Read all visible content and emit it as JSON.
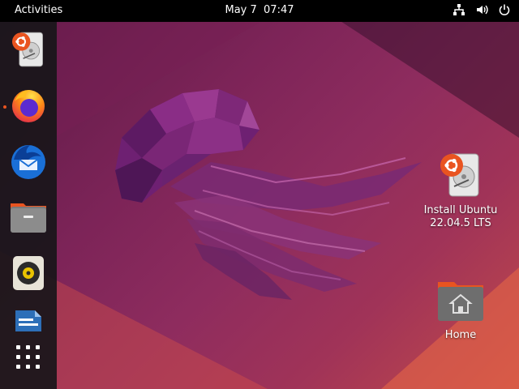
{
  "topbar": {
    "activities_label": "Activities",
    "date": "May 7",
    "time": "07:47",
    "tray_icons": [
      "network-wired-icon",
      "volume-icon",
      "power-icon"
    ]
  },
  "dock": {
    "items": [
      {
        "name": "install-ubuntu",
        "icon": "ubuntu-installer-icon",
        "running": false
      },
      {
        "name": "firefox",
        "icon": "firefox-icon",
        "running": true
      },
      {
        "name": "thunderbird",
        "icon": "thunderbird-icon",
        "running": false
      },
      {
        "name": "files",
        "icon": "files-icon",
        "running": false
      },
      {
        "name": "rhythmbox",
        "icon": "rhythmbox-icon",
        "running": false
      },
      {
        "name": "libreoffice-writer",
        "icon": "libreoffice-writer-icon",
        "running": false
      },
      {
        "name": "show-apps",
        "icon": "app-grid-icon",
        "running": false
      }
    ]
  },
  "desktop": {
    "icons": [
      {
        "icon": "ubuntu-installer-icon",
        "label_line1": "Install Ubuntu",
        "label_line2": "22.04.5 LTS"
      },
      {
        "icon": "home-folder-icon",
        "label_line1": "Home"
      }
    ]
  },
  "colors": {
    "accent": "#e95420",
    "topbar": "#000000",
    "dock": "#19161a"
  }
}
